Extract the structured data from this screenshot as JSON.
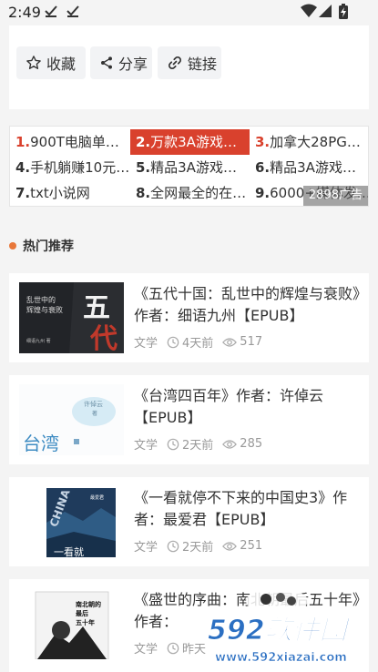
{
  "status_bar": {
    "time": "2:49"
  },
  "actions": [
    {
      "label": "收藏",
      "icon": "star-outline-icon"
    },
    {
      "label": "分享",
      "icon": "share-icon"
    },
    {
      "label": "链接",
      "icon": "link-icon"
    }
  ],
  "ad_grid": {
    "items": [
      {
        "num": "1.",
        "text": "900T电脑单…",
        "style": "red"
      },
      {
        "num": "2.",
        "text": "万款3A游戏…",
        "style": "highlight"
      },
      {
        "num": "3.",
        "text": "加拿大28PG…",
        "style": "red"
      },
      {
        "num": "4.",
        "text": "手机躺赚10元…",
        "style": "normal"
      },
      {
        "num": "5.",
        "text": "精品3A游戏…",
        "style": "normal"
      },
      {
        "num": "6.",
        "text": "精品3A游戏…",
        "style": "normal"
      },
      {
        "num": "7.",
        "text": "txt小说网",
        "style": "normal"
      },
      {
        "num": "8.",
        "text": "全网最全的在…",
        "style": "normal"
      },
      {
        "num": "9.",
        "text": "6000+媒体发…",
        "style": "normal"
      }
    ],
    "ad_label": "2898广告"
  },
  "section": {
    "title": "热门推荐"
  },
  "posts": [
    {
      "title": "《五代十国：乱世中的辉煌与衰败》作者：细语九州【EPUB】",
      "category": "文学",
      "time": "4天前",
      "views": "517",
      "cover_text": [
        "乱世中的",
        "辉煌与衰败",
        "五",
        "代",
        "细语九州 著"
      ]
    },
    {
      "title": "《台湾四百年》作者：许倬云【EPUB】",
      "category": "文学",
      "time": "2天前",
      "views": "285",
      "cover_text": [
        "许倬云",
        "著",
        "台湾"
      ]
    },
    {
      "title": "《一看就停不下来的中国史3》作者：最爱君【EPUB】",
      "category": "文学",
      "time": "2天前",
      "views": "251",
      "cover_text": [
        "CHINA",
        "一看就",
        "最爱君"
      ]
    },
    {
      "title": "《盛世的序曲：南北朝最后五十年》作者：",
      "category": "文学",
      "time": "昨天",
      "views": "",
      "cover_text": [
        "南北朝的",
        "最后",
        "五十年"
      ]
    }
  ],
  "watermark": {
    "brand": "592软件园",
    "url": "www.592xiazai.com"
  },
  "colors": {
    "accent": "#d9412d",
    "section_dot": "#e8773a",
    "meta": "#999999"
  }
}
